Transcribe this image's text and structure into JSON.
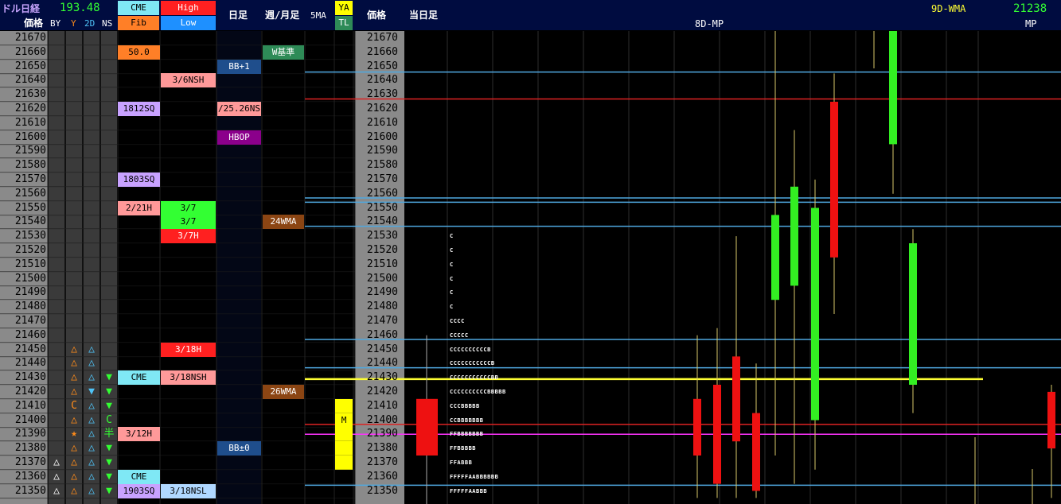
{
  "header": {
    "title": "ドル日経",
    "usd": "193.48",
    "price_label": "価格",
    "cols": [
      "BY",
      "Y",
      "2D",
      "NS"
    ],
    "cme_top": "CME",
    "cme_bottom": "Fib",
    "high": "High",
    "low": "Low",
    "daily": "日足",
    "weekly": "週/月足",
    "ma5": "5MA",
    "ya": "YA",
    "tl": "TL",
    "price_label2": "価格",
    "today": "当日足",
    "mp_title": "8D-MP",
    "wma_label": "9D-WMA",
    "wma_value": "21238",
    "mp_label": "MP"
  },
  "prices": [
    21670,
    21660,
    21650,
    21640,
    21630,
    21620,
    21610,
    21600,
    21590,
    21580,
    21570,
    21560,
    21550,
    21540,
    21530,
    21520,
    21510,
    21500,
    21490,
    21480,
    21470,
    21460,
    21450,
    21440,
    21430,
    21420,
    21410,
    21400,
    21390,
    21380,
    21370,
    21360,
    21350
  ],
  "marks": [
    {
      "price": 21450,
      "col": "Y",
      "text": "△",
      "color": "#ff8c1a"
    },
    {
      "price": 21450,
      "col": "2D",
      "text": "△",
      "color": "#4fc3f7"
    },
    {
      "price": 21440,
      "col": "Y",
      "text": "△",
      "color": "#ff8c1a"
    },
    {
      "price": 21440,
      "col": "2D",
      "text": "△",
      "color": "#4fc3f7"
    },
    {
      "price": 21430,
      "col": "Y",
      "text": "△",
      "color": "#ff8c1a"
    },
    {
      "price": 21430,
      "col": "2D",
      "text": "△",
      "color": "#4fc3f7"
    },
    {
      "price": 21430,
      "col": "NS",
      "text": "▼",
      "color": "#33ff33"
    },
    {
      "price": 21420,
      "col": "Y",
      "text": "△",
      "color": "#ff8c1a"
    },
    {
      "price": 21420,
      "col": "2D",
      "text": "▼",
      "color": "#4fc3f7"
    },
    {
      "price": 21420,
      "col": "NS",
      "text": "▼",
      "color": "#33ff33"
    },
    {
      "price": 21410,
      "col": "Y",
      "text": "C",
      "color": "#ff8c1a"
    },
    {
      "price": 21410,
      "col": "2D",
      "text": "△",
      "color": "#4fc3f7"
    },
    {
      "price": 21410,
      "col": "NS",
      "text": "▼",
      "color": "#33ff33"
    },
    {
      "price": 21400,
      "col": "Y",
      "text": "△",
      "color": "#ff8c1a"
    },
    {
      "price": 21400,
      "col": "2D",
      "text": "△",
      "color": "#4fc3f7"
    },
    {
      "price": 21400,
      "col": "NS",
      "text": "C",
      "color": "#33ff33"
    },
    {
      "price": 21390,
      "col": "Y",
      "text": "★",
      "color": "#ff8c1a"
    },
    {
      "price": 21390,
      "col": "2D",
      "text": "△",
      "color": "#4fc3f7"
    },
    {
      "price": 21390,
      "col": "NS",
      "text": "半",
      "color": "#33ff33"
    },
    {
      "price": 21380,
      "col": "Y",
      "text": "△",
      "color": "#ff8c1a"
    },
    {
      "price": 21380,
      "col": "2D",
      "text": "△",
      "color": "#4fc3f7"
    },
    {
      "price": 21380,
      "col": "NS",
      "text": "▼",
      "color": "#33ff33"
    },
    {
      "price": 21370,
      "col": "BY",
      "text": "△",
      "color": "#ffffff"
    },
    {
      "price": 21370,
      "col": "Y",
      "text": "△",
      "color": "#ff8c1a"
    },
    {
      "price": 21370,
      "col": "2D",
      "text": "△",
      "color": "#4fc3f7"
    },
    {
      "price": 21370,
      "col": "NS",
      "text": "▼",
      "color": "#33ff33"
    },
    {
      "price": 21360,
      "col": "BY",
      "text": "△",
      "color": "#ffffff"
    },
    {
      "price": 21360,
      "col": "Y",
      "text": "△",
      "color": "#ff8c1a"
    },
    {
      "price": 21360,
      "col": "2D",
      "text": "△",
      "color": "#4fc3f7"
    },
    {
      "price": 21360,
      "col": "NS",
      "text": "▼",
      "color": "#33ff33"
    },
    {
      "price": 21350,
      "col": "BY",
      "text": "△",
      "color": "#ffffff"
    },
    {
      "price": 21350,
      "col": "Y",
      "text": "△",
      "color": "#ff8c1a"
    },
    {
      "price": 21350,
      "col": "2D",
      "text": "△",
      "color": "#4fc3f7"
    },
    {
      "price": 21350,
      "col": "NS",
      "text": "▼",
      "color": "#33ff33"
    }
  ],
  "labels": [
    {
      "price": 21660,
      "col": "cme",
      "text": "50.0",
      "bg": "#ff7f27",
      "fg": "#000000"
    },
    {
      "price": 21640,
      "col": "hl",
      "text": "3/6NSH",
      "bg": "#ff9999",
      "fg": "#000000"
    },
    {
      "price": 21620,
      "col": "cme",
      "text": "1812SQ",
      "bg": "#c8a2ff",
      "fg": "#000000"
    },
    {
      "price": 21620,
      "col": "daily",
      "text": "/25.26NS",
      "bg": "#ff9999",
      "fg": "#000000"
    },
    {
      "price": 21570,
      "col": "cme",
      "text": "1803SQ",
      "bg": "#c8a2ff",
      "fg": "#000000"
    },
    {
      "price": 21550,
      "col": "cme",
      "text": "2/21H",
      "bg": "#ff9999",
      "fg": "#000000"
    },
    {
      "price": 21550,
      "col": "hl",
      "text": "3/7",
      "bg": "#33ff33",
      "fg": "#000000"
    },
    {
      "price": 21540,
      "col": "hl",
      "text": "3/7",
      "bg": "#33ff33",
      "fg": "#000000"
    },
    {
      "price": 21530,
      "col": "hl",
      "text": "3/7H",
      "bg": "#ff2020",
      "fg": "#ffffff"
    },
    {
      "price": 21450,
      "col": "hl",
      "text": "3/18H",
      "bg": "#ff2020",
      "fg": "#ffffff"
    },
    {
      "price": 21430,
      "col": "cme",
      "text": "CME",
      "bg": "#7fe8f5",
      "fg": "#000000"
    },
    {
      "price": 21430,
      "col": "hl",
      "text": "3/18NSH",
      "bg": "#ff9999",
      "fg": "#000000"
    },
    {
      "price": 21390,
      "col": "cme",
      "text": "3/12H",
      "bg": "#ff9999",
      "fg": "#000000"
    },
    {
      "price": 21360,
      "col": "cme",
      "text": "CME",
      "bg": "#7fe8f5",
      "fg": "#000000"
    },
    {
      "price": 21350,
      "col": "cme",
      "text": "1903SQ",
      "bg": "#c8a2ff",
      "fg": "#000000"
    },
    {
      "price": 21350,
      "col": "hl",
      "text": "3/18NSL",
      "bg": "#b0d8ff",
      "fg": "#000000"
    },
    {
      "price": 21650,
      "col": "daily",
      "text": "BB+1",
      "bg": "#1f4e8c",
      "fg": "#ffffff"
    },
    {
      "price": 21600,
      "col": "daily",
      "text": "HBOP",
      "bg": "#8b008b",
      "fg": "#ffffff"
    },
    {
      "price": 21380,
      "col": "daily",
      "text": "BB±0",
      "bg": "#1f4e8c",
      "fg": "#ffffff"
    },
    {
      "price": 21660,
      "col": "weekly",
      "text": "W基準",
      "bg": "#2e8b57",
      "fg": "#ffffff"
    },
    {
      "price": 21540,
      "col": "weekly",
      "text": "24WMA",
      "bg": "#8b4513",
      "fg": "#ffffff"
    },
    {
      "price": 21420,
      "col": "weekly",
      "text": "26WMA",
      "bg": "#8b4513",
      "fg": "#ffffff"
    },
    {
      "price": 21400,
      "col": "ya",
      "text": "M",
      "bg": "#ffff00",
      "fg": "#000000"
    }
  ],
  "ya_fill": [
    21410,
    21390,
    21380,
    21370
  ],
  "tpo": [
    {
      "price": 21530,
      "text": "C"
    },
    {
      "price": 21520,
      "text": "C"
    },
    {
      "price": 21510,
      "text": "C"
    },
    {
      "price": 21500,
      "text": "C"
    },
    {
      "price": 21490,
      "text": "C"
    },
    {
      "price": 21480,
      "text": "C"
    },
    {
      "price": 21470,
      "text": "CCCC"
    },
    {
      "price": 21460,
      "text": "CCCCC"
    },
    {
      "price": 21450,
      "text": "CCCCCCCCCCB"
    },
    {
      "price": 21440,
      "text": "CCCCCCCCCCCB"
    },
    {
      "price": 21430,
      "text": "CCCCCCCCCCCBB"
    },
    {
      "price": 21420,
      "text": "CCCCCCCCCCBBBBB"
    },
    {
      "price": 21410,
      "text": "CCCBBBBB"
    },
    {
      "price": 21400,
      "text": "CCBBBBBBB"
    },
    {
      "price": 21390,
      "text": "FFBBBBBBB"
    },
    {
      "price": 21380,
      "text": "FFBBBBB"
    },
    {
      "price": 21370,
      "text": "FFABBB"
    },
    {
      "price": 21360,
      "text": "FFFFFAABBBBBB"
    },
    {
      "price": 21350,
      "text": "FFFFFAABBB"
    }
  ],
  "hlines": [
    {
      "price": 21641,
      "color": "#4fa8e0"
    },
    {
      "price": 21622,
      "color": "#dd2222"
    },
    {
      "price": 21552,
      "color": "#4fa8e0"
    },
    {
      "price": 21549,
      "color": "#4fa8e0"
    },
    {
      "price": 21532,
      "color": "#4fa8e0"
    },
    {
      "price": 21452,
      "color": "#4fa8e0"
    },
    {
      "price": 21432,
      "color": "#4fa8e0"
    },
    {
      "price": 21424,
      "color": "#ffff33"
    },
    {
      "price": 21392,
      "color": "#dd2222"
    },
    {
      "price": 21385,
      "color": "#ff33ff"
    },
    {
      "price": 21349,
      "color": "#4fa8e0"
    }
  ],
  "chart_data": {
    "type": "candlestick",
    "title": "8D-MP",
    "ylim": [
      21345,
      21675
    ],
    "candles": [
      {
        "open": 21410,
        "close": 21370,
        "high": 21455,
        "low": 21340,
        "color": "red"
      },
      {
        "open": 21420,
        "close": 21350,
        "high": 21460,
        "low": 21340,
        "color": "red"
      },
      {
        "open": 21440,
        "close": 21380,
        "high": 21525,
        "low": 21340,
        "color": "red"
      },
      {
        "open": 21400,
        "close": 21345,
        "high": 21435,
        "low": 21340,
        "color": "red"
      },
      {
        "open": 21480,
        "close": 21540,
        "high": 21670,
        "low": 21370,
        "color": "green"
      },
      {
        "open": 21560,
        "close": 21490,
        "high": 21600,
        "low": 21350,
        "color": "green"
      },
      {
        "open": 21395,
        "close": 21545,
        "high": 21565,
        "low": 21360,
        "color": "green"
      },
      {
        "open": 21620,
        "close": 21510,
        "high": 21640,
        "low": 21470,
        "color": "red"
      },
      {
        "open": 21590,
        "close": 21675,
        "high": 21690,
        "low": 21555,
        "color": "green"
      },
      {
        "open": 21420,
        "close": 21520,
        "high": 21530,
        "low": 21400,
        "color": "green"
      },
      {
        "open": 21415,
        "close": 21375,
        "high": 21420,
        "low": 21340,
        "color": "red"
      }
    ]
  }
}
